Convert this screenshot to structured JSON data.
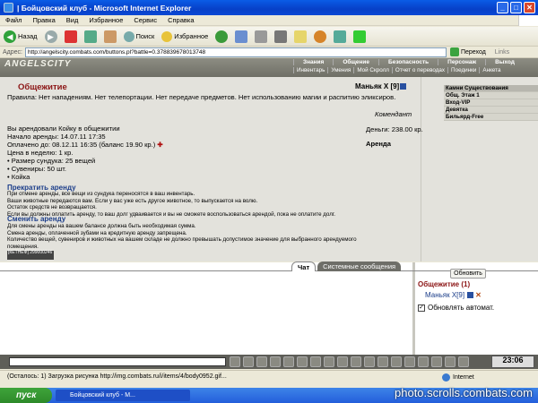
{
  "window": {
    "title": "| Бойцовский клуб - Microsoft Internet Explorer",
    "controls": {
      "minimize": "_",
      "maximize": "□",
      "close": "✕"
    }
  },
  "menu": [
    "Файл",
    "Правка",
    "Вид",
    "Избранное",
    "Сервис",
    "Справка"
  ],
  "toolbar": {
    "back": "Назад",
    "search": "Поиск",
    "favorites": "Избранное"
  },
  "address": {
    "label": "Адрес:",
    "url": "http://angelscity.combats.com/buttons.pl?battle=0.378839678013748",
    "go": "Переход",
    "links": "Links"
  },
  "site": {
    "logo": "ANGELSCITY",
    "nav_top": [
      "Знания",
      "Общение",
      "Безопасность",
      "Персонаж",
      "Выход"
    ],
    "nav_bottom": [
      "Инвентарь",
      "Умения",
      "Мой Скролл",
      "Отчет о переводах",
      "Поединки",
      "Анкета"
    ]
  },
  "room": {
    "title": "Общежитие",
    "user": "Маньяк X",
    "user_level": "[9]",
    "rules": "Правила: Нет нападениям. Нет телепортации. Нет передаче предметов. Нет использованию магии и распитию эликсиров.",
    "commandant": "Комендант",
    "rented": "Вы арендовали Койку в общежитии",
    "start": "Начало аренды: 14.07.11 17:35",
    "paid": "Оплачено до: 08.12.11 16:35 (баланс 19.90 кр.)",
    "plus": "✚",
    "price": "Цена в неделю: 1 кр.",
    "bullets": [
      "• Размер сундука: 25 вещей",
      "• Сувениры: 50 шт.",
      "• Койка"
    ],
    "money": "Деньги: 238.00 кр.",
    "arenda": "Аренда",
    "extend_link": "Прекратить аренду",
    "extend_text": [
      "При отмене аренды, все вещи из сундука переносятся в ваш инвентарь.",
      "Ваши животные передаются вам. Если у вас уже есть другое животное, то выпускается на волю.",
      "Остаток средств не возвращается.",
      "Если вы должны оплатить аренду, то ваш долг удваивается и вы не сможете воспользоваться арендой, пока не оплатите долг."
    ],
    "change_link": "Сменить аренду",
    "change_text": [
      "Для смены аренды на вашем балансе должна быть необходимая сумма.",
      "Смена аренды, оплаченной зубами на кредитную аренду запрещена.",
      "Количество вещей, сувениров и животных на вашем складе не должно превышать допустимое значение для выбранного арендуемого",
      "помещения."
    ],
    "counter": "[КЕТНЕФ] 299000246"
  },
  "sidebar": [
    "Камни Существования",
    "Общ. Этаж 1",
    "Вход-VIP",
    "Девятка",
    "Бильярд-Free"
  ],
  "chat": {
    "tabs": [
      "Чат",
      "Системные сообщения"
    ],
    "refresh": "Обновить",
    "room_header": "Общежитие (1)",
    "room_user": "Маньяк X[9]",
    "auto_refresh": "Обновлять автомат.",
    "auto_checked": true
  },
  "clock": {
    "time": "23:06"
  },
  "status": {
    "text": "(Осталось: 1) Загрузка рисунка http://img.combats.ru/i/items/4/body0952.gif...",
    "zone": "Internet"
  },
  "taskbar": {
    "start": "пуск",
    "task": "Бойцовский клуб - М...",
    "watermark": "photo.scrolls.combats.com"
  }
}
